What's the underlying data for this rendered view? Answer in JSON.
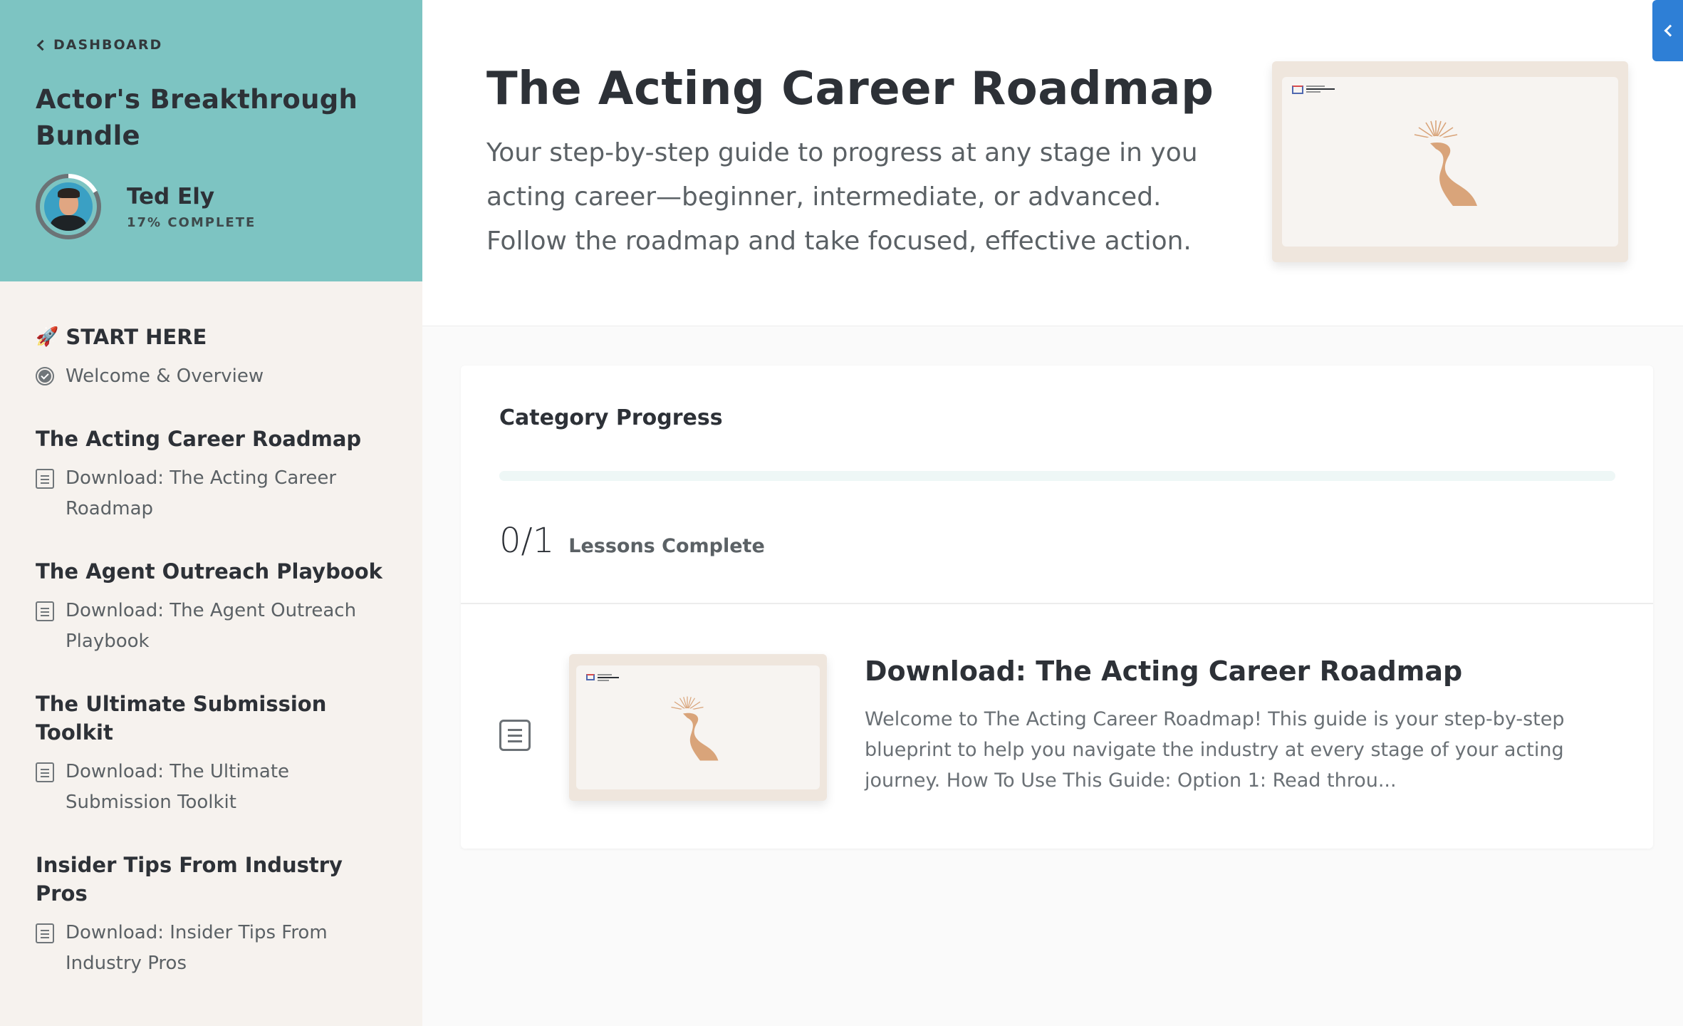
{
  "sidebar": {
    "back_label": "DASHBOARD",
    "course_title": "Actor's Breakthrough Bundle",
    "student_name": "Ted Ely",
    "student_progress": "17% COMPLETE",
    "progress_percent": 17,
    "sections": [
      {
        "title": "START HERE",
        "icon": "rocket-icon",
        "lessons": [
          {
            "label": "Welcome & Overview",
            "icon": "check-circle-icon"
          }
        ]
      },
      {
        "title": "The Acting Career Roadmap",
        "lessons": [
          {
            "label": "Download: The Acting Career Roadmap",
            "icon": "document-icon"
          }
        ]
      },
      {
        "title": "The Agent Outreach Playbook",
        "lessons": [
          {
            "label": "Download: The Agent Outreach Playbook",
            "icon": "document-icon"
          }
        ]
      },
      {
        "title": "The Ultimate Submission Toolkit",
        "lessons": [
          {
            "label": "Download: The Ultimate Submission Toolkit",
            "icon": "document-icon"
          }
        ]
      },
      {
        "title": "Insider Tips From Industry Pros",
        "lessons": [
          {
            "label": "Download: Insider Tips From Industry Pros",
            "icon": "document-icon"
          }
        ]
      }
    ]
  },
  "hero": {
    "title": "The Acting Career Roadmap",
    "description": "Your step-by-step guide to progress at any stage in you acting career—beginner, intermediate, or advanced. Follow the roadmap and take focused, effective action."
  },
  "category": {
    "title": "Category Progress",
    "completed": "0/1",
    "completed_label": "Lessons Complete",
    "progress_fraction": 0
  },
  "lesson": {
    "title": "Download: The Acting Career Roadmap",
    "description": "Welcome to The Acting Career Roadmap! This guide is your step-by-step blueprint to help you navigate the industry at every stage of your acting journey. How To Use This Guide: Option 1: Read throu..."
  },
  "colors": {
    "accent": "#7dc4c2",
    "sidebar_bg": "#f6f2ee",
    "collapse_tab": "#2e7fd6",
    "thumb_art": "#d9a47a"
  }
}
